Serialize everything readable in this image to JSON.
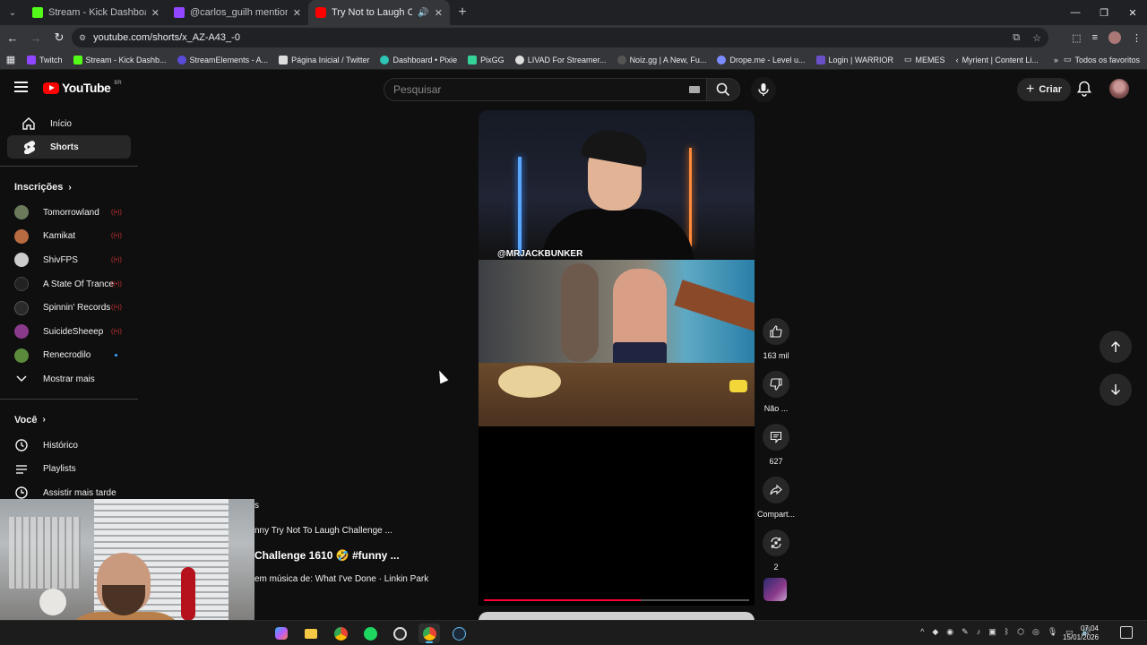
{
  "browser": {
    "tabs": [
      {
        "title": "Stream - Kick Dashboard",
        "color": "#53fc18",
        "active": false
      },
      {
        "title": "@carlos_guilh mentioned y",
        "color": "#9146ff",
        "active": false
      },
      {
        "title": "Try Not to Laugh Challenge",
        "color": "#ff0000",
        "active": true
      }
    ],
    "url": "youtube.com/shorts/x_AZ-A43_-0",
    "bookmarks": [
      {
        "label": "Twitch",
        "color": "#9146ff"
      },
      {
        "label": "Stream - Kick Dashb...",
        "color": "#53fc18"
      },
      {
        "label": "StreamElements - A...",
        "color": "#5b4bdb"
      },
      {
        "label": "Página Inicial / Twitter",
        "color": "#ffffff"
      },
      {
        "label": "Dashboard • Pixie",
        "color": "#2ec4b6"
      },
      {
        "label": "PixGG",
        "color": "#36d399"
      },
      {
        "label": "LIVAD For Streamer...",
        "color": "#dddddd"
      },
      {
        "label": "Noiz.gg | A New, Fu...",
        "color": "#333333"
      },
      {
        "label": "Drope.me - Level u...",
        "color": "#7b8cff"
      },
      {
        "label": "Login | WARRIOR",
        "color": "#6a4fc9"
      },
      {
        "label": "MEMES",
        "color": "#bbbbbb"
      },
      {
        "label": "Myrient | Content Li...",
        "color": "#999999"
      }
    ],
    "all_bookmarks_label": "Todos os favoritos"
  },
  "youtube": {
    "logo_text": "YouTube",
    "country_code": "BR",
    "search_placeholder": "Pesquisar",
    "create_label": "Criar",
    "sidebar": {
      "primary": [
        {
          "label": "Início",
          "active": false
        },
        {
          "label": "Shorts",
          "active": true
        }
      ],
      "subscriptions_title": "Inscrições",
      "subscriptions": [
        {
          "label": "Tomorrowland",
          "indicator": "live",
          "color": "#6b7a5a"
        },
        {
          "label": "Kamikat",
          "indicator": "live",
          "color": "#b86a40"
        },
        {
          "label": "ShivFPS",
          "indicator": "live",
          "color": "#cccccc"
        },
        {
          "label": "A State Of Trance",
          "indicator": "live",
          "color": "#222222"
        },
        {
          "label": "Spinnin' Records",
          "indicator": "live",
          "color": "#2a2a2a"
        },
        {
          "label": "SuicideSheeep",
          "indicator": "live",
          "color": "#8a3a8a"
        },
        {
          "label": "Renecrodilo",
          "indicator": "new",
          "color": "#5a8a3a"
        }
      ],
      "show_more": "Mostrar mais",
      "you_title": "Você",
      "you_items": [
        {
          "label": "Histórico"
        },
        {
          "label": "Playlists"
        },
        {
          "label": "Assistir mais tarde"
        }
      ]
    },
    "short": {
      "handle": "@MRJACKBUNKER",
      "progress_fraction": 0.59,
      "overlay_top": "s",
      "overlay_small": "nny Try Not To Laugh Challenge ...",
      "overlay_title": "Challenge 1610 🤣 #funny ...",
      "overlay_music": "em música de: What I've Done · Linkin Park"
    },
    "actions": {
      "likes": "163 mil",
      "dislike": "Não ...",
      "comments": "627",
      "share": "Compart...",
      "remix": "2"
    }
  },
  "taskbar": {
    "time": "07:04",
    "date": "15/01/2026"
  }
}
